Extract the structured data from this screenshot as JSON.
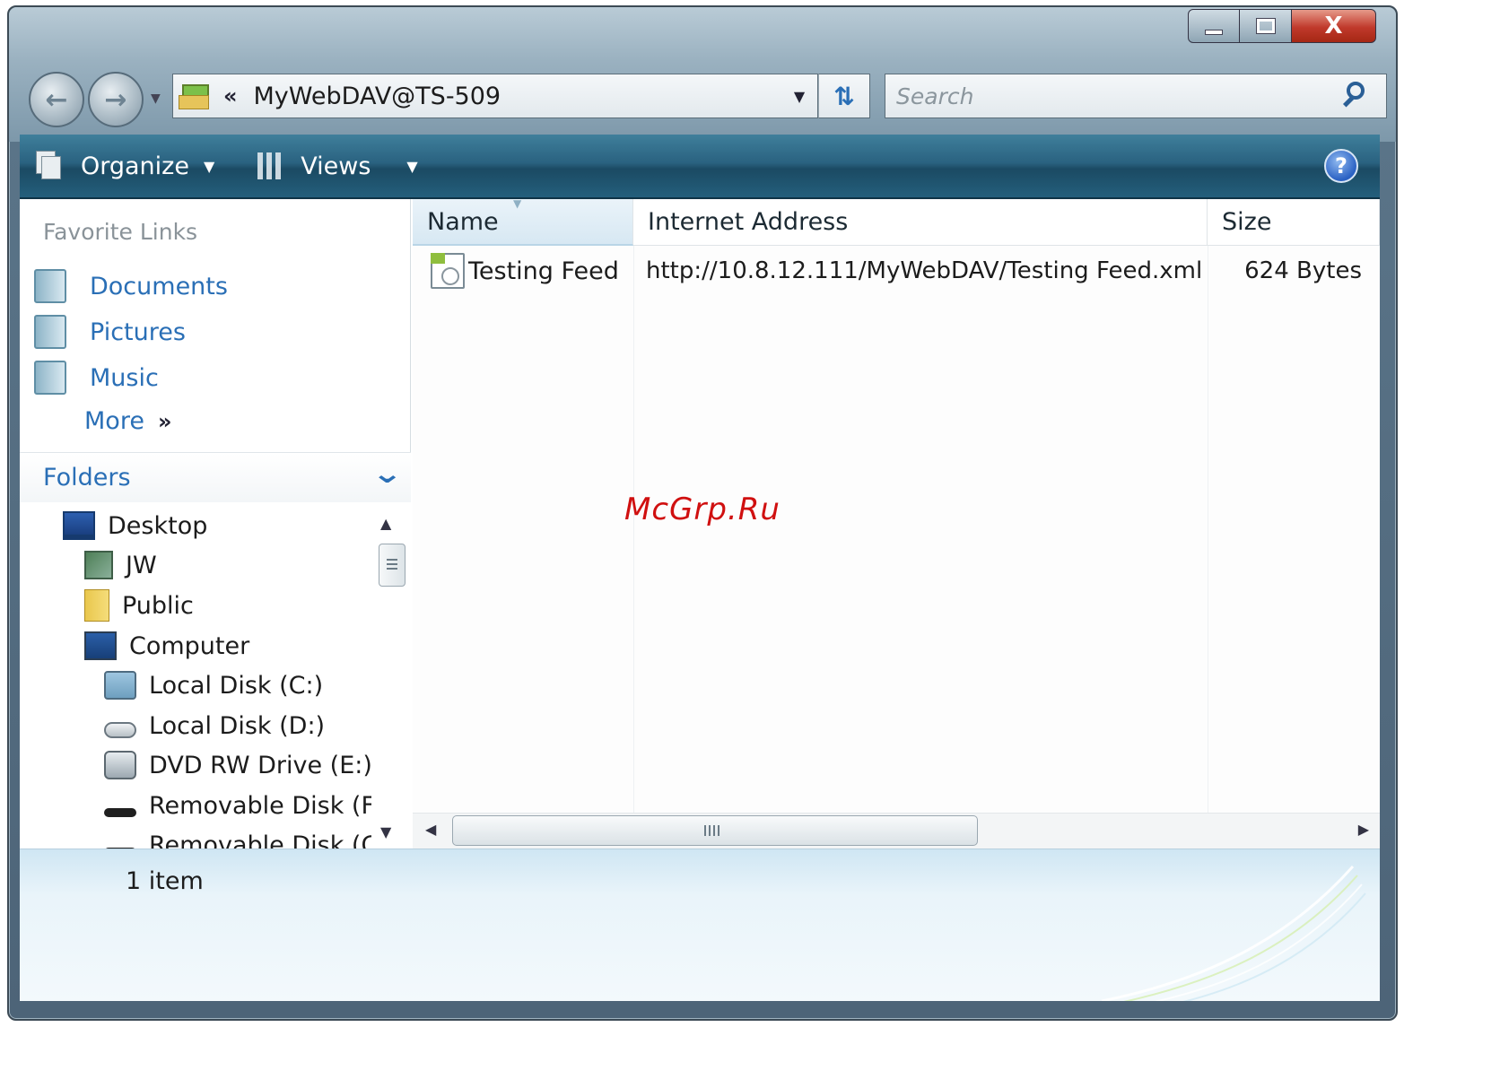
{
  "window": {
    "caption": {
      "minimize": "",
      "maximize": "",
      "close": "X"
    }
  },
  "nav": {
    "back_icon": "back-arrow-icon",
    "forward_icon": "forward-arrow-icon",
    "address_prefix": "«",
    "address": "MyWebDAV@TS-509",
    "search_placeholder": "Search"
  },
  "toolbar": {
    "organize": "Organize",
    "views": "Views",
    "help": "?"
  },
  "favorites": {
    "header": "Favorite Links",
    "items": [
      {
        "label": "Documents",
        "icon": "documents-icon"
      },
      {
        "label": "Pictures",
        "icon": "pictures-icon"
      },
      {
        "label": "Music",
        "icon": "music-icon"
      }
    ],
    "more": "More",
    "more_arrow": "»"
  },
  "folders": {
    "header": "Folders",
    "tree": [
      {
        "label": "Desktop",
        "icon": "desktop-icon"
      },
      {
        "label": "JW",
        "icon": "user-folder-icon"
      },
      {
        "label": "Public",
        "icon": "public-folder-icon"
      },
      {
        "label": "Computer",
        "icon": "computer-icon"
      },
      {
        "label": "Local Disk (C:)",
        "icon": "system-drive-icon"
      },
      {
        "label": "Local Disk (D:)",
        "icon": "hard-drive-icon"
      },
      {
        "label": "DVD RW Drive (E:)",
        "icon": "dvd-drive-icon"
      },
      {
        "label": "Removable Disk (F:)",
        "icon": "removable-disk-icon"
      },
      {
        "label": "Removable Disk (G:)",
        "icon": "removable-disk-icon"
      }
    ]
  },
  "list": {
    "columns": [
      "Name",
      "Internet Address",
      "Size"
    ],
    "rows": [
      {
        "name": "Testing Feed",
        "address": "http://10.8.12.111/MyWebDAV/Testing Feed.xml",
        "size": "624 Bytes",
        "icon": "feed-file-icon"
      }
    ]
  },
  "details": {
    "count": "1 item"
  },
  "watermark": "McGrp.Ru",
  "colors": {
    "command_bar": "#2a6280",
    "link_blue": "#2a6fb6",
    "close_red": "#c0392b"
  }
}
